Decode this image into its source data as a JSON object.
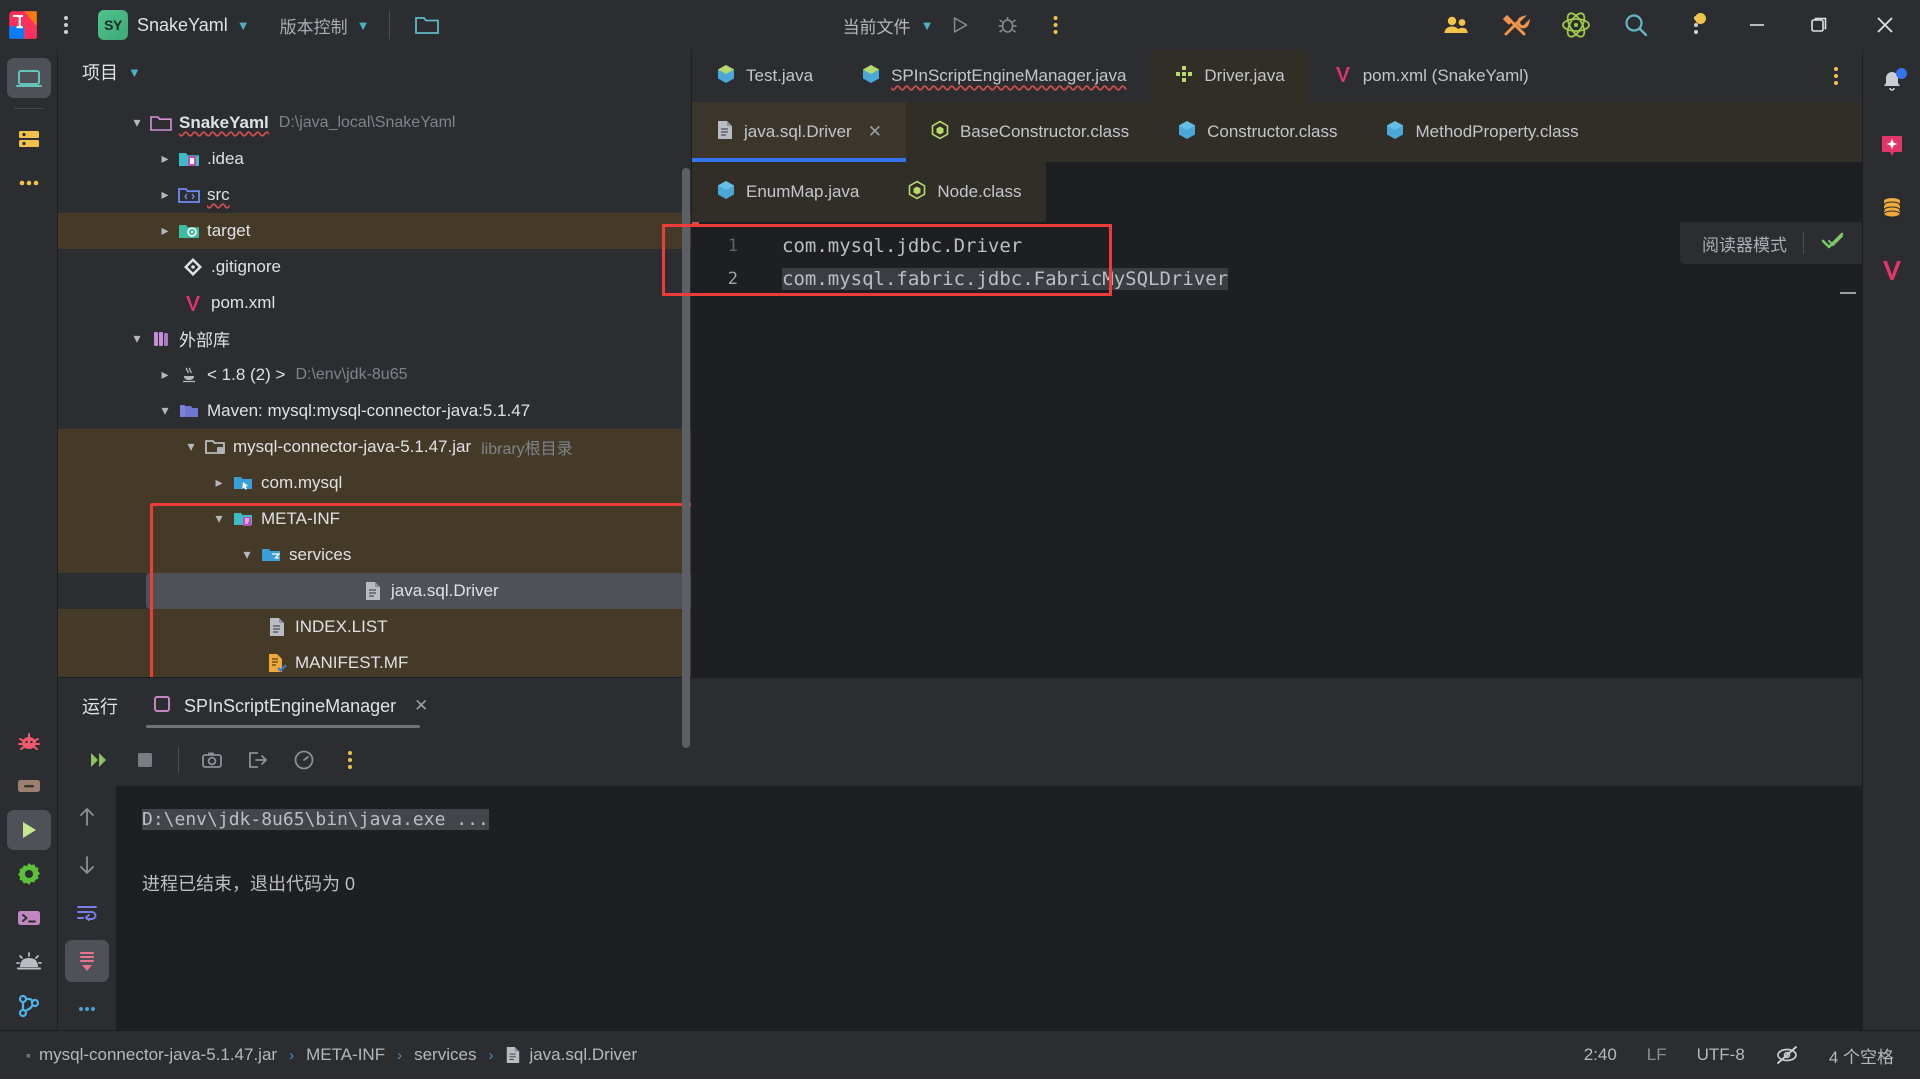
{
  "titlebar": {
    "logo_icon": "intellij-idea-logo",
    "main_menu_icon": "kebab-menu-icon",
    "project_badge": "SY",
    "project_name": "SnakeYaml",
    "project_chevron_icon": "chevron-down-icon",
    "vcs_label": "版本控制",
    "vcs_chevron_icon": "chevron-down-icon",
    "folder_icon": "folder-icon",
    "run_config_label": "当前文件",
    "run_config_chevron_icon": "chevron-down-icon",
    "run_icon": "run-play-icon",
    "debug_icon": "debug-bug-icon",
    "more_run_icon": "kebab-menu-icon",
    "icons": [
      {
        "name": "code-with-me-users-icon",
        "glyph": "users"
      },
      {
        "name": "tools-hammer-wrench-icon",
        "glyph": "tools"
      },
      {
        "name": "ai-assistant-atom-icon",
        "glyph": "atom"
      },
      {
        "name": "search-everywhere-icon",
        "glyph": "search"
      },
      {
        "name": "notifications-kebab-icon",
        "glyph": "kebab-badge"
      }
    ],
    "window_minimize": "minimize-icon",
    "window_maximize": "maximize-restore-icon",
    "window_close": "close-icon"
  },
  "left_rail": {
    "items": [
      {
        "name": "project-tool-window-icon",
        "glyph": "project",
        "active": true
      },
      {
        "name": "commit-tool-window-icon",
        "glyph": "commit",
        "active": false
      },
      {
        "name": "more-tool-windows-icon",
        "glyph": "ellipsis",
        "active": false
      }
    ],
    "bottom_items": [
      {
        "name": "debug-tool-window-icon",
        "glyph": "bug",
        "active": false
      },
      {
        "name": "terminal-drawer-icon",
        "glyph": "drawer",
        "active": false
      },
      {
        "name": "run-tool-window-icon",
        "glyph": "play",
        "active": true
      },
      {
        "name": "services-gear-icon",
        "glyph": "gear",
        "active": false
      },
      {
        "name": "terminal-tool-window-icon",
        "glyph": "terminal",
        "active": false
      },
      {
        "name": "problems-alert-icon",
        "glyph": "alarm",
        "active": false
      },
      {
        "name": "version-control-branch-icon",
        "glyph": "branch",
        "active": false
      }
    ]
  },
  "project_tool_window": {
    "title": "项目",
    "title_chevron_icon": "chevron-down-icon",
    "tree": [
      {
        "indent": 0,
        "twisty": "expanded",
        "icon": "folder-module-icon",
        "label": "SnakeYaml",
        "bold": true,
        "sub": "D:\\java_local\\SnakeYaml",
        "squiggle": true,
        "row": "normal"
      },
      {
        "indent": 1,
        "twisty": "collapsed",
        "icon": "folder-idea-icon",
        "label": ".idea",
        "sub": "",
        "row": "normal"
      },
      {
        "indent": 1,
        "twisty": "collapsed",
        "icon": "folder-source-icon",
        "label": "src",
        "sub": "",
        "squiggle": true,
        "row": "normal"
      },
      {
        "indent": 1,
        "twisty": "collapsed",
        "icon": "folder-target-icon",
        "label": "target",
        "sub": "",
        "row": "brown"
      },
      {
        "indent": 2,
        "twisty": "none",
        "icon": "gitignore-file-icon",
        "label": ".gitignore",
        "sub": "",
        "row": "normal"
      },
      {
        "indent": 2,
        "twisty": "none",
        "icon": "maven-pom-icon",
        "label": "pom.xml",
        "sub": "",
        "row": "normal"
      },
      {
        "indent": 0,
        "twisty": "expanded",
        "icon": "external-libraries-icon",
        "label": "外部库",
        "sub": "",
        "row": "normal"
      },
      {
        "indent": 1,
        "twisty": "collapsed",
        "icon": "java-sdk-icon",
        "label": "< 1.8 (2) >",
        "sub": "D:\\env\\jdk-8u65",
        "row": "normal"
      },
      {
        "indent": 1,
        "twisty": "expanded",
        "icon": "library-icon",
        "label": "Maven: mysql:mysql-connector-java:5.1.47",
        "sub": "",
        "row": "normal"
      },
      {
        "indent": 2,
        "twisty": "expanded",
        "icon": "jar-root-icon",
        "label": "mysql-connector-java-5.1.47.jar",
        "sub": "library根目录",
        "row": "brown"
      },
      {
        "indent": 3,
        "twisty": "collapsed",
        "icon": "package-icon",
        "label": "com.mysql",
        "sub": "",
        "row": "brown"
      },
      {
        "indent": 3,
        "twisty": "expanded",
        "icon": "folder-meta-inf-icon",
        "label": "META-INF",
        "sub": "",
        "row": "brown"
      },
      {
        "indent": 4,
        "twisty": "expanded",
        "icon": "folder-services-icon",
        "label": "services",
        "sub": "",
        "row": "brown"
      },
      {
        "indent": 5,
        "twisty": "none",
        "icon": "text-file-icon",
        "label": "java.sql.Driver",
        "sub": "",
        "row": "selected"
      },
      {
        "indent": 4,
        "twisty": "none",
        "icon": "text-file-icon",
        "label": "INDEX.LIST",
        "sub": "",
        "row": "brown"
      },
      {
        "indent": 4,
        "twisty": "none",
        "icon": "manifest-file-icon",
        "label": "MANIFEST.MF",
        "sub": "",
        "row": "brown"
      }
    ]
  },
  "editor": {
    "tabs_row1": [
      {
        "label": "Test.java",
        "icon": "java-file-icon",
        "active": false,
        "error": false
      },
      {
        "label": "SPInScriptEngineManager.java",
        "icon": "java-file-icon",
        "active": false,
        "error": true
      },
      {
        "label": "Driver.java",
        "icon": "class-decompiled-icon",
        "active": true,
        "error": false
      },
      {
        "label": "pom.xml (SnakeYaml)",
        "icon": "maven-pom-icon",
        "active": false,
        "error": false
      }
    ],
    "tabs_row1_kebab": "tab-list-kebab-icon",
    "tabs_row2": [
      {
        "label": "java.sql.Driver",
        "icon": "text-file-icon",
        "selected": true,
        "closable": true
      },
      {
        "label": "BaseConstructor.class",
        "icon": "class-green-icon",
        "selected": false,
        "closable": false
      },
      {
        "label": "Constructor.class",
        "icon": "class-blue-icon",
        "selected": false,
        "closable": false
      },
      {
        "label": "MethodProperty.class",
        "icon": "class-blue-icon",
        "selected": false,
        "closable": false
      }
    ],
    "tabs_row3": [
      {
        "label": "EnumMap.java",
        "icon": "class-blue-icon",
        "selected": false,
        "closable": false
      },
      {
        "label": "Node.class",
        "icon": "class-green-icon",
        "selected": false,
        "closable": false
      }
    ],
    "close_tab_icon": "close-icon",
    "gutter": [
      "1",
      "2"
    ],
    "code_lines": [
      {
        "text": "com.mysql.jdbc.Driver",
        "highlighted": false
      },
      {
        "text": "com.mysql.fabric.jdbc.FabricMySQLDriver",
        "highlighted": true
      }
    ],
    "reader_mode_label": "阅读器模式",
    "inspection_status_icon": "inspections-ok-checkmark-icon"
  },
  "run_tool_window": {
    "title": "运行",
    "tab_label": "SPInScriptEngineManager",
    "tab_icon": "run-config-square-icon",
    "tab_close_icon": "close-icon",
    "toolbar": [
      {
        "name": "rerun-button",
        "glyph": "rerun"
      },
      {
        "name": "stop-button",
        "glyph": "stop"
      },
      {
        "name": "screenshot-button",
        "glyph": "camera"
      },
      {
        "name": "export-button",
        "glyph": "export"
      },
      {
        "name": "profiler-button",
        "glyph": "gauge"
      },
      {
        "name": "more-options-button",
        "glyph": "kebab"
      }
    ],
    "side_buttons": [
      {
        "name": "previous-occurrence-button",
        "glyph": "arrow-up",
        "active": false
      },
      {
        "name": "next-occurrence-button",
        "glyph": "arrow-down",
        "active": false
      },
      {
        "name": "soft-wrap-button",
        "glyph": "wrap",
        "active": false
      },
      {
        "name": "scroll-to-end-button",
        "glyph": "scroll-end",
        "active": true
      },
      {
        "name": "more-side-options-button",
        "glyph": "dots",
        "active": false
      }
    ],
    "console_lines": [
      {
        "text": "D:\\env\\jdk-8u65\\bin\\java.exe ...",
        "mono": true,
        "selected": true
      },
      {
        "text": "",
        "mono": true,
        "selected": false
      },
      {
        "text": "进程已结束，退出代码为 0",
        "mono": false,
        "selected": false
      }
    ]
  },
  "right_rail": {
    "items": [
      {
        "name": "notifications-bell-icon",
        "glyph": "bell",
        "badge": true
      },
      {
        "name": "ai-assistant-icon",
        "glyph": "ai-spark"
      },
      {
        "name": "database-tool-window-icon",
        "glyph": "database"
      },
      {
        "name": "maven-tool-window-icon",
        "glyph": "maven"
      }
    ]
  },
  "status_bar": {
    "breadcrumb": [
      "mysql-connector-java-5.1.47.jar",
      "META-INF",
      "services",
      "java.sql.Driver"
    ],
    "breadcrumb_file_icon": "text-file-icon",
    "breadcrumb_separator": "›",
    "caret_position": "2:40",
    "line_separator": "LF",
    "encoding": "UTF-8",
    "readonly_icon": "read-only-eye-off-icon",
    "indent": "4 个空格"
  },
  "colors": {
    "bg_chrome": "#2b2d30",
    "bg_editor": "#1e1f22",
    "accent_blue": "#3574f0",
    "highlight_box_red": "#f03b3b",
    "brown_highlight": "#453a28",
    "selection_gray": "#4e5157",
    "text_primary": "#dfe1e5",
    "text_dim": "#7f848c"
  }
}
